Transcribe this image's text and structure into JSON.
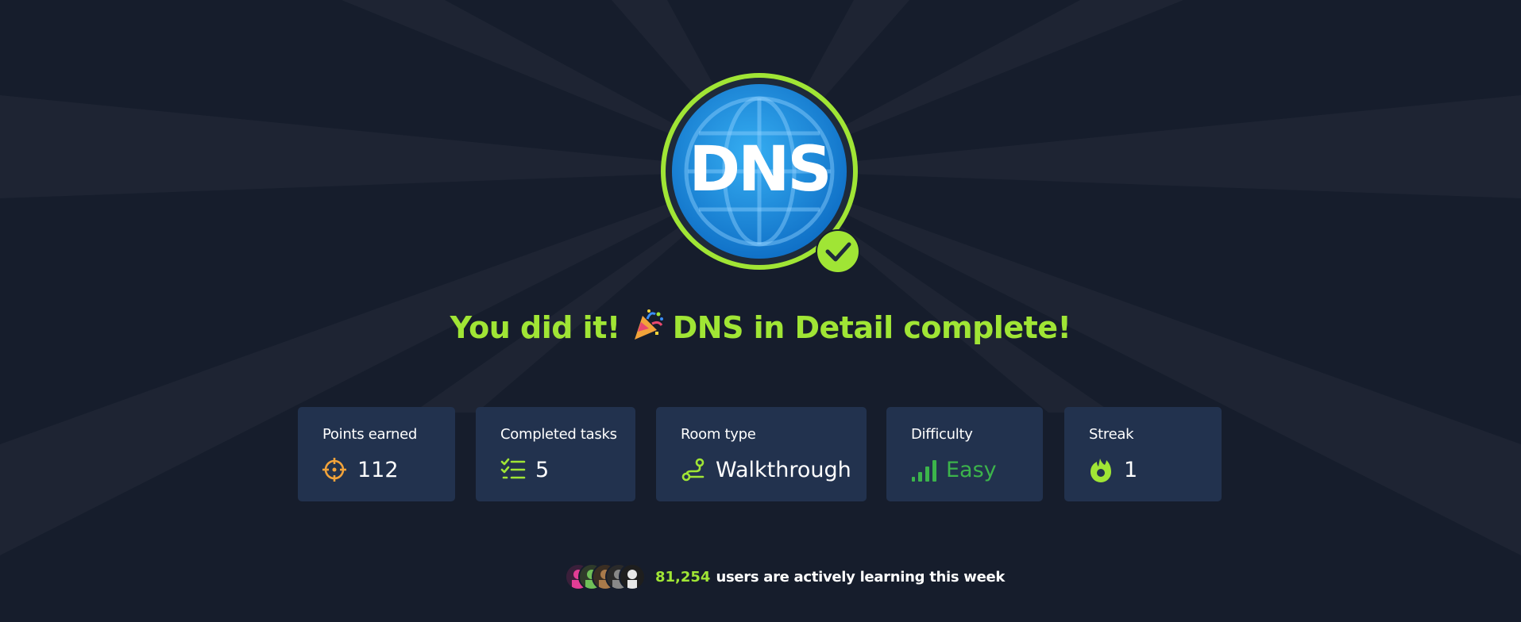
{
  "badge": {
    "text": "DNS",
    "colors": {
      "ring": "#a0e535",
      "globe": "#1d8fe0",
      "check": "#a0e535"
    }
  },
  "headline": {
    "prefix": "You did it!",
    "emoji": "party-popper-icon",
    "suffix": "DNS in Detail complete!"
  },
  "stats": [
    {
      "label": "Points earned",
      "value": "112",
      "icon": "target-icon"
    },
    {
      "label": "Completed tasks",
      "value": "5",
      "icon": "task-list-icon"
    },
    {
      "label": "Room type",
      "value": "Walkthrough",
      "icon": "route-icon"
    },
    {
      "label": "Difficulty",
      "value": "Easy",
      "icon": "signal-bars-icon"
    },
    {
      "label": "Streak",
      "value": "1",
      "icon": "flame-icon"
    }
  ],
  "learners": {
    "count": "81,254",
    "text": "users are actively learning this week"
  },
  "colors": {
    "background": "#161d2c",
    "card": "#22324e",
    "accent": "#a0e535",
    "easy": "#3cb44b",
    "points": "#f2a33a"
  }
}
